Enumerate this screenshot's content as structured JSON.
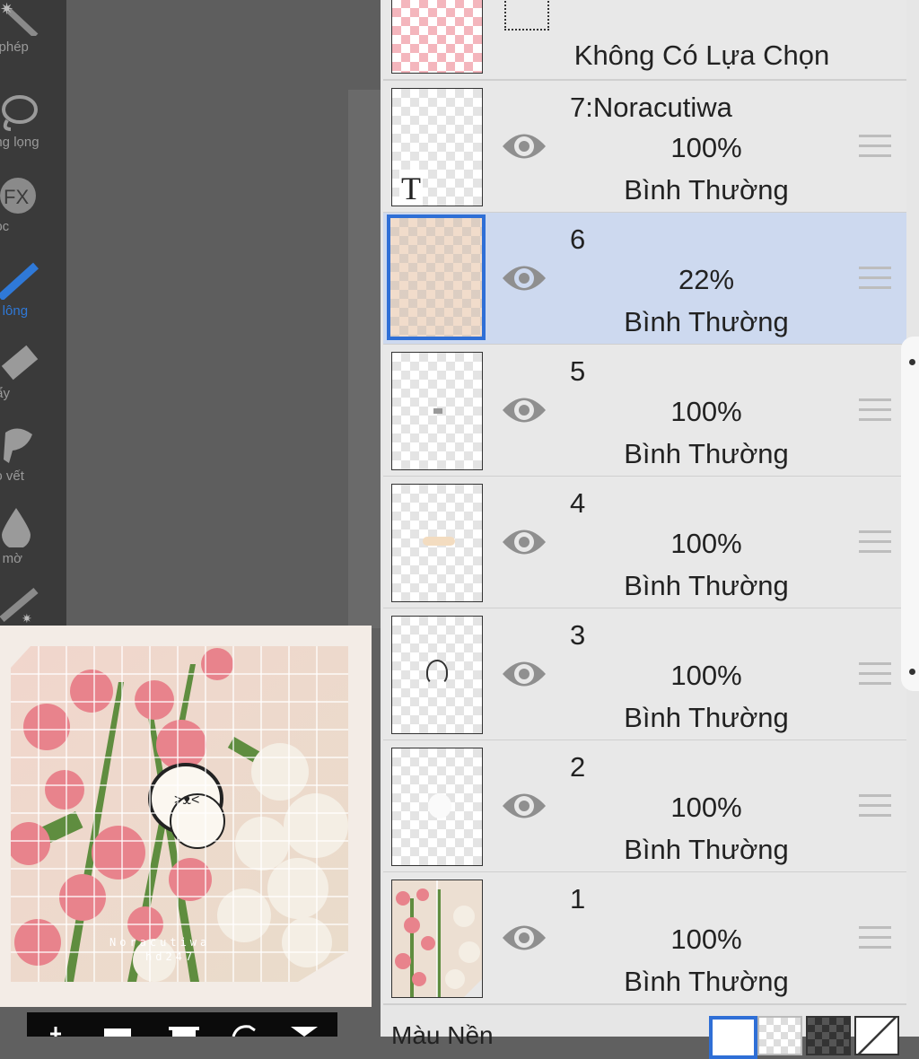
{
  "toolbar": {
    "items": [
      {
        "label": "a phép",
        "icon": "magic-wand-icon"
      },
      {
        "label": "ong lọng",
        "icon": "lasso-icon"
      },
      {
        "label": "Lọc",
        "icon": "fx-filter-icon"
      },
      {
        "label": "út lông",
        "icon": "brush-icon",
        "active": true
      },
      {
        "label": "Tẩy",
        "icon": "eraser-icon"
      },
      {
        "label": "ao vết",
        "icon": "smudge-icon"
      },
      {
        "label": "m mờ",
        "icon": "blur-drop-icon"
      }
    ]
  },
  "layers_panel": {
    "top_row_label": "Không Có Lựa Chọn",
    "layers": [
      {
        "name": "7:Noracutiwa",
        "opacity": "100%",
        "blend": "Bình Thường",
        "thumb": "text",
        "thumb_text": "T"
      },
      {
        "name": "6",
        "opacity": "22%",
        "blend": "Bình Thường",
        "selected": true
      },
      {
        "name": "5",
        "opacity": "100%",
        "blend": "Bình Thường"
      },
      {
        "name": "4",
        "opacity": "100%",
        "blend": "Bình Thường"
      },
      {
        "name": "3",
        "opacity": "100%",
        "blend": "Bình Thường"
      },
      {
        "name": "2",
        "opacity": "100%",
        "blend": "Bình Thường"
      },
      {
        "name": "1",
        "opacity": "100%",
        "blend": "Bình Thường"
      }
    ],
    "background_label": "Màu Nền"
  },
  "preview": {
    "watermark_line1": "Noracutiwa",
    "watermark_line2": "hd247"
  },
  "colors": {
    "selected_row": "#cdd9ef",
    "accent_blue": "#2f6fd6"
  }
}
